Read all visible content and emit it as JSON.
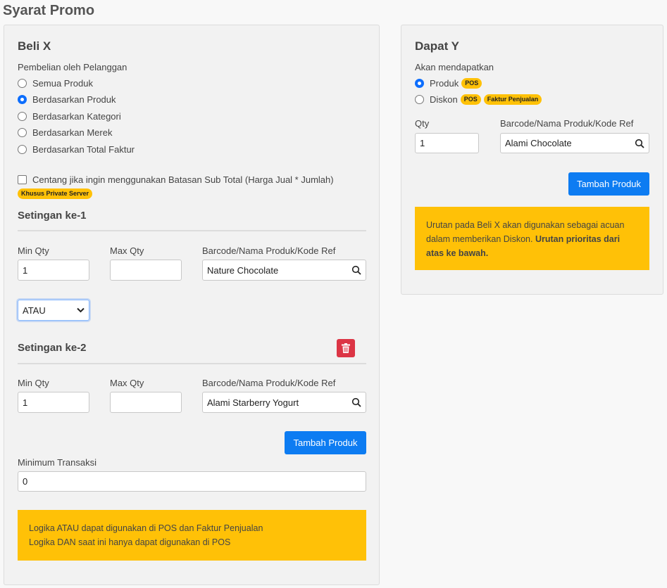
{
  "page": {
    "title": "Syarat Promo"
  },
  "left": {
    "title": "Beli X",
    "purchase_label": "Pembelian oleh Pelanggan",
    "options": [
      {
        "label": "Semua Produk",
        "checked": false
      },
      {
        "label": "Berdasarkan Produk",
        "checked": true
      },
      {
        "label": "Berdasarkan Kategori",
        "checked": false
      },
      {
        "label": "Berdasarkan Merek",
        "checked": false
      },
      {
        "label": "Berdasarkan Total Faktur",
        "checked": false
      }
    ],
    "subtotal_checkbox_label": "Centang jika ingin menggunakan Batasan Sub Total (Harga Jual * Jumlah)",
    "private_server_badge": "Khusus Private Server",
    "setting1": {
      "title": "Setingan ke-1",
      "min_qty_label": "Min Qty",
      "max_qty_label": "Max Qty",
      "product_label": "Barcode/Nama Produk/Kode Ref",
      "min_qty_value": "1",
      "max_qty_value": "",
      "product_value": "Nature Chocolate"
    },
    "logic_select": "ATAU",
    "setting2": {
      "title": "Setingan ke-2",
      "min_qty_label": "Min Qty",
      "max_qty_label": "Max Qty",
      "product_label": "Barcode/Nama Produk/Kode Ref",
      "min_qty_value": "1",
      "max_qty_value": "",
      "product_value": "Alami Starberry Yogurt"
    },
    "add_product_label": "Tambah Produk",
    "min_transaction_label": "Minimum Transaksi",
    "min_transaction_value": "0",
    "alert_lines": [
      "Logika ATAU dapat digunakan di POS dan Faktur Penjualan",
      "Logika DAN saat ini hanya dapat digunakan di POS"
    ]
  },
  "right": {
    "title": "Dapat Y",
    "receive_label": "Akan mendapatkan",
    "option_product": "Produk",
    "option_discount": "Diskon",
    "badge_pos": "POS",
    "badge_faktur": "Faktur Penjualan",
    "qty_label": "Qty",
    "product_label": "Barcode/Nama Produk/Kode Ref",
    "qty_value": "1",
    "product_value": "Alami Chocolate",
    "add_product_label": "Tambah Produk",
    "alert_text": "Urutan pada Beli X akan digunakan sebagai acuan dalam memberikan Diskon.",
    "alert_bold": "Urutan prioritas dari atas ke bawah."
  },
  "colors": {
    "primary": "#0d7cf2",
    "warning": "#ffc107",
    "danger": "#dc3545"
  },
  "icons": {
    "search": "search-icon",
    "trash": "trash-icon",
    "chevron": "chevron-down-icon"
  }
}
